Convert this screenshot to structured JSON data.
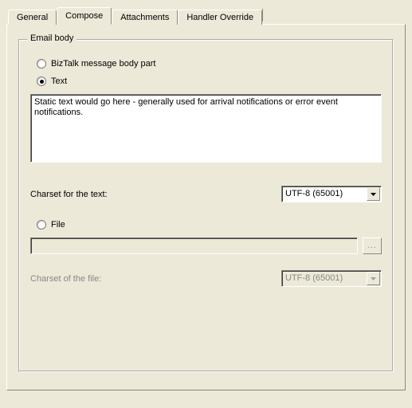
{
  "tabs": {
    "general": "General",
    "compose": "Compose",
    "attachments": "Attachments",
    "handler_override": "Handler Override",
    "active": "compose"
  },
  "group": {
    "legend": "Email body"
  },
  "radios": {
    "biztalk_label": "BizTalk message body part",
    "text_label": "Text",
    "file_label": "File",
    "selected": "text"
  },
  "textarea": {
    "value": "Static text would go here - generally used for arrival notifications or error event notifications."
  },
  "charset_text": {
    "label": "Charset for the text:",
    "value": "UTF-8 (65001)"
  },
  "file_path": {
    "value": ""
  },
  "browse": {
    "label": "..."
  },
  "charset_file": {
    "label": "Charset of the file:",
    "value": "UTF-8 (65001)"
  }
}
